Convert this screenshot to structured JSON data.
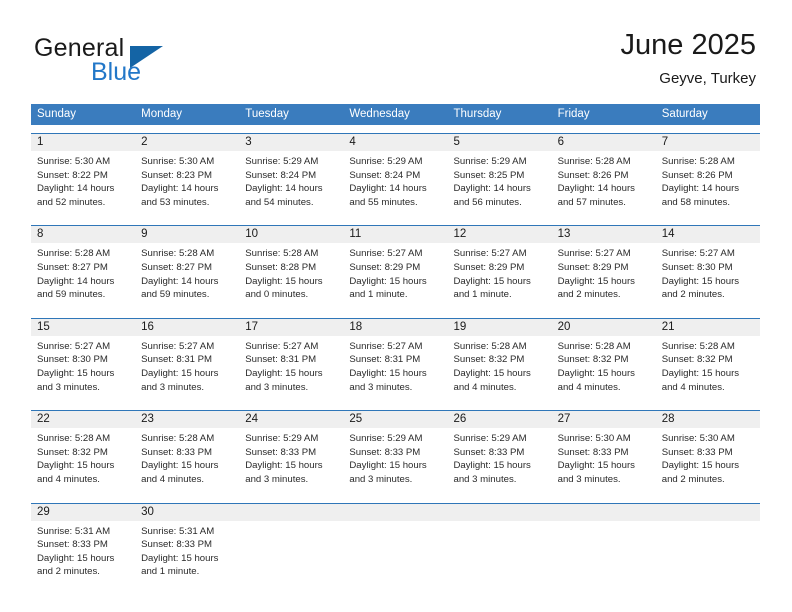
{
  "brand": {
    "name_part1": "General",
    "name_part2": "Blue",
    "triangle_color": "#1464a5",
    "blue_color": "#2277c8"
  },
  "header": {
    "title": "June 2025",
    "location": "Geyve, Turkey"
  },
  "theme": {
    "header_row_bg": "#3a7cbe",
    "week_rule": "#2f76b8",
    "day_number_bg": "#efefef"
  },
  "weekdays": [
    "Sunday",
    "Monday",
    "Tuesday",
    "Wednesday",
    "Thursday",
    "Friday",
    "Saturday"
  ],
  "weeks": [
    [
      {
        "day": "1",
        "sunrise": "Sunrise: 5:30 AM",
        "sunset": "Sunset: 8:22 PM",
        "daylight": "Daylight: 14 hours and 52 minutes."
      },
      {
        "day": "2",
        "sunrise": "Sunrise: 5:30 AM",
        "sunset": "Sunset: 8:23 PM",
        "daylight": "Daylight: 14 hours and 53 minutes."
      },
      {
        "day": "3",
        "sunrise": "Sunrise: 5:29 AM",
        "sunset": "Sunset: 8:24 PM",
        "daylight": "Daylight: 14 hours and 54 minutes."
      },
      {
        "day": "4",
        "sunrise": "Sunrise: 5:29 AM",
        "sunset": "Sunset: 8:24 PM",
        "daylight": "Daylight: 14 hours and 55 minutes."
      },
      {
        "day": "5",
        "sunrise": "Sunrise: 5:29 AM",
        "sunset": "Sunset: 8:25 PM",
        "daylight": "Daylight: 14 hours and 56 minutes."
      },
      {
        "day": "6",
        "sunrise": "Sunrise: 5:28 AM",
        "sunset": "Sunset: 8:26 PM",
        "daylight": "Daylight: 14 hours and 57 minutes."
      },
      {
        "day": "7",
        "sunrise": "Sunrise: 5:28 AM",
        "sunset": "Sunset: 8:26 PM",
        "daylight": "Daylight: 14 hours and 58 minutes."
      }
    ],
    [
      {
        "day": "8",
        "sunrise": "Sunrise: 5:28 AM",
        "sunset": "Sunset: 8:27 PM",
        "daylight": "Daylight: 14 hours and 59 minutes."
      },
      {
        "day": "9",
        "sunrise": "Sunrise: 5:28 AM",
        "sunset": "Sunset: 8:27 PM",
        "daylight": "Daylight: 14 hours and 59 minutes."
      },
      {
        "day": "10",
        "sunrise": "Sunrise: 5:28 AM",
        "sunset": "Sunset: 8:28 PM",
        "daylight": "Daylight: 15 hours and 0 minutes."
      },
      {
        "day": "11",
        "sunrise": "Sunrise: 5:27 AM",
        "sunset": "Sunset: 8:29 PM",
        "daylight": "Daylight: 15 hours and 1 minute."
      },
      {
        "day": "12",
        "sunrise": "Sunrise: 5:27 AM",
        "sunset": "Sunset: 8:29 PM",
        "daylight": "Daylight: 15 hours and 1 minute."
      },
      {
        "day": "13",
        "sunrise": "Sunrise: 5:27 AM",
        "sunset": "Sunset: 8:29 PM",
        "daylight": "Daylight: 15 hours and 2 minutes."
      },
      {
        "day": "14",
        "sunrise": "Sunrise: 5:27 AM",
        "sunset": "Sunset: 8:30 PM",
        "daylight": "Daylight: 15 hours and 2 minutes."
      }
    ],
    [
      {
        "day": "15",
        "sunrise": "Sunrise: 5:27 AM",
        "sunset": "Sunset: 8:30 PM",
        "daylight": "Daylight: 15 hours and 3 minutes."
      },
      {
        "day": "16",
        "sunrise": "Sunrise: 5:27 AM",
        "sunset": "Sunset: 8:31 PM",
        "daylight": "Daylight: 15 hours and 3 minutes."
      },
      {
        "day": "17",
        "sunrise": "Sunrise: 5:27 AM",
        "sunset": "Sunset: 8:31 PM",
        "daylight": "Daylight: 15 hours and 3 minutes."
      },
      {
        "day": "18",
        "sunrise": "Sunrise: 5:27 AM",
        "sunset": "Sunset: 8:31 PM",
        "daylight": "Daylight: 15 hours and 3 minutes."
      },
      {
        "day": "19",
        "sunrise": "Sunrise: 5:28 AM",
        "sunset": "Sunset: 8:32 PM",
        "daylight": "Daylight: 15 hours and 4 minutes."
      },
      {
        "day": "20",
        "sunrise": "Sunrise: 5:28 AM",
        "sunset": "Sunset: 8:32 PM",
        "daylight": "Daylight: 15 hours and 4 minutes."
      },
      {
        "day": "21",
        "sunrise": "Sunrise: 5:28 AM",
        "sunset": "Sunset: 8:32 PM",
        "daylight": "Daylight: 15 hours and 4 minutes."
      }
    ],
    [
      {
        "day": "22",
        "sunrise": "Sunrise: 5:28 AM",
        "sunset": "Sunset: 8:32 PM",
        "daylight": "Daylight: 15 hours and 4 minutes."
      },
      {
        "day": "23",
        "sunrise": "Sunrise: 5:28 AM",
        "sunset": "Sunset: 8:33 PM",
        "daylight": "Daylight: 15 hours and 4 minutes."
      },
      {
        "day": "24",
        "sunrise": "Sunrise: 5:29 AM",
        "sunset": "Sunset: 8:33 PM",
        "daylight": "Daylight: 15 hours and 3 minutes."
      },
      {
        "day": "25",
        "sunrise": "Sunrise: 5:29 AM",
        "sunset": "Sunset: 8:33 PM",
        "daylight": "Daylight: 15 hours and 3 minutes."
      },
      {
        "day": "26",
        "sunrise": "Sunrise: 5:29 AM",
        "sunset": "Sunset: 8:33 PM",
        "daylight": "Daylight: 15 hours and 3 minutes."
      },
      {
        "day": "27",
        "sunrise": "Sunrise: 5:30 AM",
        "sunset": "Sunset: 8:33 PM",
        "daylight": "Daylight: 15 hours and 3 minutes."
      },
      {
        "day": "28",
        "sunrise": "Sunrise: 5:30 AM",
        "sunset": "Sunset: 8:33 PM",
        "daylight": "Daylight: 15 hours and 2 minutes."
      }
    ],
    [
      {
        "day": "29",
        "sunrise": "Sunrise: 5:31 AM",
        "sunset": "Sunset: 8:33 PM",
        "daylight": "Daylight: 15 hours and 2 minutes."
      },
      {
        "day": "30",
        "sunrise": "Sunrise: 5:31 AM",
        "sunset": "Sunset: 8:33 PM",
        "daylight": "Daylight: 15 hours and 1 minute."
      },
      {
        "day": "",
        "sunrise": "",
        "sunset": "",
        "daylight": ""
      },
      {
        "day": "",
        "sunrise": "",
        "sunset": "",
        "daylight": ""
      },
      {
        "day": "",
        "sunrise": "",
        "sunset": "",
        "daylight": ""
      },
      {
        "day": "",
        "sunrise": "",
        "sunset": "",
        "daylight": ""
      },
      {
        "day": "",
        "sunrise": "",
        "sunset": "",
        "daylight": ""
      }
    ]
  ]
}
